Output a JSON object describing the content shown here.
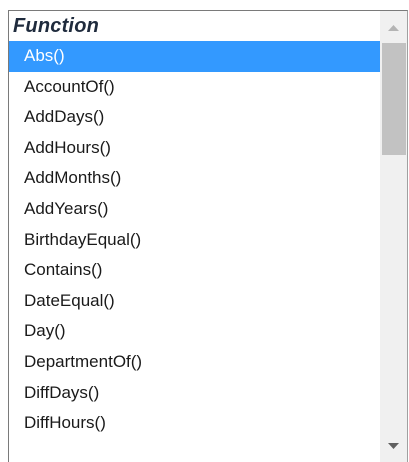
{
  "list": {
    "header": "Function",
    "items": [
      "Abs()",
      "AccountOf()",
      "AddDays()",
      "AddHours()",
      "AddMonths()",
      "AddYears()",
      "BirthdayEqual()",
      "Contains()",
      "DateEqual()",
      "Day()",
      "DepartmentOf()",
      "DiffDays()",
      "DiffHours()"
    ],
    "selected_index": 0
  },
  "scrollbar": {
    "up_icon": "arrow-up-icon",
    "down_icon": "arrow-down-icon",
    "colors": {
      "track": "#f0f0f0",
      "thumb": "#c2c2c2",
      "selection": "#3399ff"
    }
  }
}
